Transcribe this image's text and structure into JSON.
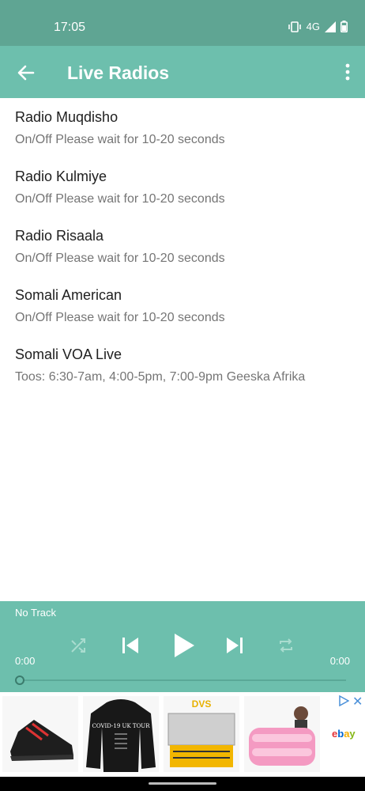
{
  "status": {
    "time": "17:05",
    "network": "4G"
  },
  "app_bar": {
    "title": "Live Radios"
  },
  "radios": [
    {
      "name": "Radio Muqdisho",
      "subtitle": "On/Off Please wait for 10-20 seconds"
    },
    {
      "name": "Radio Kulmiye",
      "subtitle": "On/Off Please wait for 10-20 seconds"
    },
    {
      "name": "Radio Risaala",
      "subtitle": "On/Off Please wait for 10-20 seconds"
    },
    {
      "name": "Somali American",
      "subtitle": "On/Off Please wait for 10-20 seconds"
    },
    {
      "name": "Somali VOA Live",
      "subtitle": "Toos: 6:30-7am, 4:00-5pm, 7:00-9pm Geeska Afrika"
    }
  ],
  "player": {
    "track": "No Track",
    "elapsed": "0:00",
    "duration": "0:00",
    "progress": 0
  },
  "ads": {
    "ebay_label": "ebay",
    "close_label": "✕",
    "hoodie_text": "COVID-19 UK TOUR",
    "box_brand": "DVS"
  },
  "colors": {
    "status_bar": "#5fa593",
    "app_bar": "#6dbfad",
    "player": "#6dbfad"
  }
}
